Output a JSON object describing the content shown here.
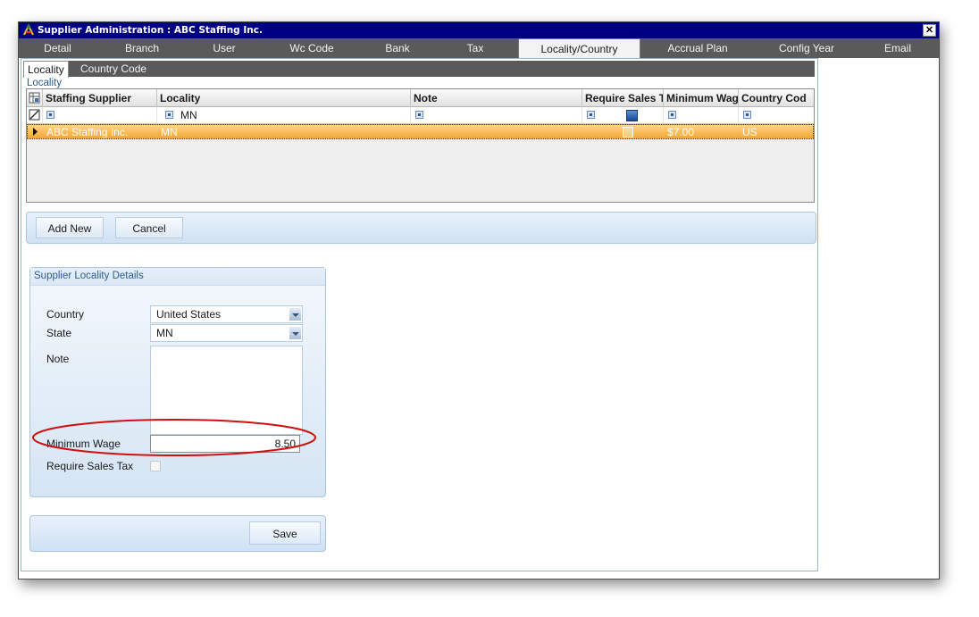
{
  "window": {
    "title": "Supplier Administration : ABC Staffing Inc.",
    "close_glyph": "✕"
  },
  "tabs": [
    "Detail",
    "Branch",
    "User",
    "Wc Code",
    "Bank",
    "Tax",
    "Locality/Country",
    "Accrual Plan",
    "Config Year",
    "Email"
  ],
  "active_tab": "Locality/Country",
  "subtabs": [
    "Locality",
    "Country Code"
  ],
  "active_subtab": "Locality",
  "locality_group_label": "Locality",
  "grid": {
    "columns": [
      "Staffing Supplier",
      "Locality",
      "Note",
      "Require Sales T",
      "Minimum Wag",
      "Country Cod"
    ],
    "filter": {
      "locality": "MN"
    },
    "rows": [
      {
        "staffing_supplier": "ABC Staffing Inc.",
        "locality": "MN",
        "note": "",
        "require_sales_tax": false,
        "minimum_wage": "$7.00",
        "country_code": "US"
      }
    ]
  },
  "buttons": {
    "add_new": "Add New",
    "cancel": "Cancel",
    "save": "Save"
  },
  "details": {
    "title": "Supplier Locality Details",
    "country_label": "Country",
    "country_value": "United States",
    "state_label": "State",
    "state_value": "MN",
    "note_label": "Note",
    "note_value": "",
    "min_wage_label": "Minimum Wage",
    "min_wage_value": "8.50",
    "require_sales_tax_label": "Require Sales Tax",
    "require_sales_tax_checked": false
  },
  "colors": {
    "title_bar": "#000080",
    "tab_bar": "#5a5a5a",
    "selected_row": "#f6a631",
    "annotation": "#d01010"
  }
}
